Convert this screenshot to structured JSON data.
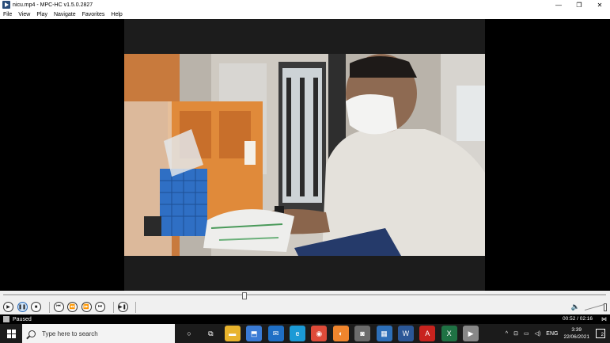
{
  "window": {
    "title": "nicu.mp4 - MPC-HC v1.5.0.2827",
    "minimize": "—",
    "maximize": "❐",
    "close": "✕"
  },
  "menu": [
    "File",
    "View",
    "Play",
    "Navigate",
    "Favorites",
    "Help"
  ],
  "playback": {
    "position_fraction": 0.4,
    "status": "Paused",
    "time": "00:52 / 02:16",
    "volume_fraction": 1.0
  },
  "controls": {
    "play": "▶",
    "pause": "❚❚",
    "stop": "■",
    "prev": "⏮",
    "rewind": "⏪",
    "forward": "⏩",
    "next": "⏭",
    "frame_step": "▶❚"
  },
  "taskbar": {
    "search_placeholder": "Type here to search",
    "icons": [
      {
        "name": "cortana-icon",
        "glyph": "○",
        "bg": "transparent",
        "active": false
      },
      {
        "name": "task-view-icon",
        "glyph": "⧉",
        "bg": "transparent",
        "active": false
      },
      {
        "name": "file-explorer-icon",
        "glyph": "▬",
        "bg": "#e8b32c",
        "active": false
      },
      {
        "name": "store-icon",
        "glyph": "⬒",
        "bg": "#3a7bd5",
        "active": false
      },
      {
        "name": "mail-icon",
        "glyph": "✉",
        "bg": "#1f6fc5",
        "active": false
      },
      {
        "name": "edge-icon",
        "glyph": "e",
        "bg": "#1b9ad6",
        "active": false
      },
      {
        "name": "chrome-icon",
        "glyph": "◉",
        "bg": "#de4b39",
        "active": false
      },
      {
        "name": "firefox-icon",
        "glyph": "◐",
        "bg": "#f0852d",
        "active": false
      },
      {
        "name": "camera-icon",
        "glyph": "◙",
        "bg": "#6b6b6b",
        "active": false
      },
      {
        "name": "photos-icon",
        "glyph": "▦",
        "bg": "#2d6fb8",
        "active": false
      },
      {
        "name": "word-icon",
        "glyph": "W",
        "bg": "#2b5797",
        "active": false
      },
      {
        "name": "acrobat-icon",
        "glyph": "A",
        "bg": "#c8231e",
        "active": false
      },
      {
        "name": "excel-icon",
        "glyph": "X",
        "bg": "#1f7244",
        "active": false
      },
      {
        "name": "mpc-hc-icon",
        "glyph": "▶",
        "bg": "#888888",
        "active": true
      }
    ],
    "tray": {
      "chevron": "^",
      "network": "⊡",
      "battery": "▭",
      "volume": "◁)",
      "language": "ENG",
      "time": "3:39",
      "date": "22/06/2021",
      "notifications": "2"
    }
  }
}
